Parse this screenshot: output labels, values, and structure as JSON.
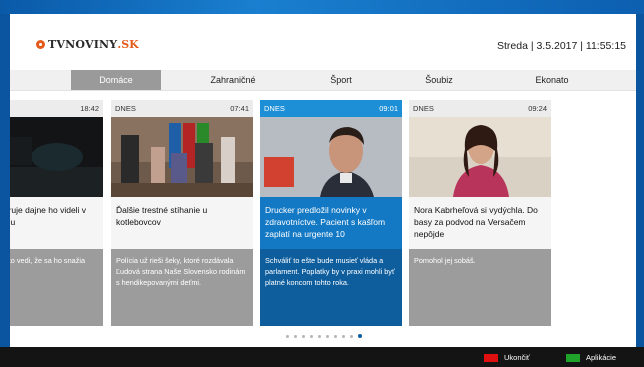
{
  "header": {
    "logo_main": "TVNOVINY",
    "logo_tld": ".SK",
    "datetime": "Streda | 3.5.2017 | 11:55:15"
  },
  "nav": [
    {
      "label": "Domáce",
      "active": true
    },
    {
      "label": "Zahraničné",
      "active": false
    },
    {
      "label": "Šport",
      "active": false
    },
    {
      "label": "Šoubiz",
      "active": false
    },
    {
      "label": "Ekonato",
      "active": false
    }
  ],
  "cards": [
    {
      "source": "",
      "time": "18:42",
      "title": "školy vyšetruje dajne ho videli v rostitútkou",
      "description": "koly ale všetko vedi, že sa ho snažia ovať.",
      "active": false
    },
    {
      "source": "DNES",
      "time": "07:41",
      "title": "Ďalšie trestné stíhanie u kotlebovcov",
      "description": "Polícia už rieši šeky, ktoré rozdávala Ľudová strana Naše Slovensko rodinám s hendikepovanými deťmi.",
      "active": false
    },
    {
      "source": "DNES",
      "time": "09:01",
      "title": "Drucker predložil novinky v zdravotníctve. Pacient s kašľom zaplatí na urgente 10",
      "description": "Schváliť to ešte bude musieť vláda a parlament. Poplatky by v praxi mohli byť platné koncom tohto roka.",
      "active": true
    },
    {
      "source": "DNES",
      "time": "09:24",
      "title": "Nora Kabrheľová si vydýchla. Do basy za podvod na Versačem nepôjde",
      "description": "Pomohol jej sobáš.",
      "active": false
    }
  ],
  "pagination": {
    "total": 10,
    "active_index": 9
  },
  "footer": {
    "exit_label": "Ukončiť",
    "exit_color": "#e01010",
    "apps_label": "Aplikácie",
    "apps_color": "#1fa32a"
  },
  "colors": {
    "accent_blue": "#1479c4",
    "accent_dark": "#0e5e9e",
    "logo_orange": "#e45a1a"
  }
}
